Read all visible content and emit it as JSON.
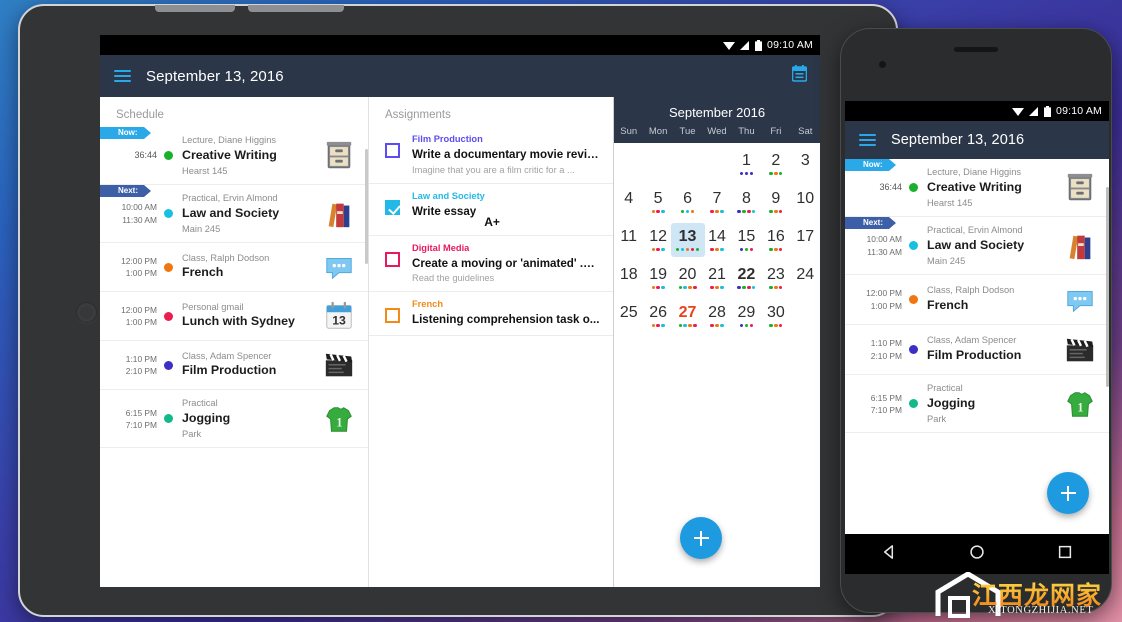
{
  "background": {
    "colors": [
      "#2f7fc4",
      "#3b2e96",
      "#e08fa6"
    ]
  },
  "statusbar": {
    "time": "09:10 AM",
    "icons": [
      "wifi-icon",
      "signal-icon",
      "battery-icon"
    ]
  },
  "appbar": {
    "menu_icon": "hamburger-menu-icon",
    "title": "September 13, 2016",
    "action_icon": "calendar-icon",
    "accent": "#29a8e8",
    "background": "#2b3648"
  },
  "schedule": {
    "header": "Schedule",
    "badges": {
      "now": "Now:",
      "next": "Next:",
      "now_color": "#2aa8e8",
      "next_color": "#3d5fa8"
    },
    "items": [
      {
        "badge": "now",
        "countdown": "36:44",
        "start": "",
        "end": "",
        "subtitle": "Lecture, Diane Higgins",
        "title": "Creative Writing",
        "location": "Hearst 145",
        "dot": "#19b02b",
        "icon": "file-cabinet-icon"
      },
      {
        "badge": "next",
        "countdown": "",
        "start": "10:00 AM",
        "end": "11:30 AM",
        "subtitle": "Practical, Ervin Almond",
        "title": "Law and Society",
        "location": "Main 245",
        "dot": "#19bfe0",
        "icon": "books-icon"
      },
      {
        "badge": "",
        "countdown": "",
        "start": "12:00 PM",
        "end": "1:00 PM",
        "subtitle": "Class, Ralph Dodson",
        "title": "French",
        "location": "",
        "dot": "#f2760f",
        "icon": "chat-bubble-icon"
      },
      {
        "badge": "",
        "countdown": "",
        "start": "12:00 PM",
        "end": "1:00 PM",
        "subtitle": "Personal gmail",
        "title": "Lunch with Sydney",
        "location": "",
        "dot": "#ea1d4e",
        "icon": "calendar-13-icon"
      },
      {
        "badge": "",
        "countdown": "",
        "start": "1:10 PM",
        "end": "2:10 PM",
        "subtitle": "Class, Adam Spencer",
        "title": "Film Production",
        "location": "",
        "dot": "#3b2fc4",
        "icon": "clapperboard-icon"
      },
      {
        "badge": "",
        "countdown": "",
        "start": "6:15 PM",
        "end": "7:10 PM",
        "subtitle": "Practical",
        "title": "Jogging",
        "location": "Park",
        "dot": "#13b98a",
        "icon": "green-shirt-icon"
      }
    ],
    "phone_items": [
      {
        "badge": "now",
        "countdown": "36:44",
        "start": "",
        "end": "",
        "subtitle": "Lecture, Diane Higgins",
        "title": "Creative Writing",
        "location": "Hearst 145",
        "dot": "#19b02b",
        "icon": "file-cabinet-icon"
      },
      {
        "badge": "next",
        "countdown": "",
        "start": "10:00 AM",
        "end": "11:30 AM",
        "subtitle": "Practical, Ervin Almond",
        "title": "Law and Society",
        "location": "Main 245",
        "dot": "#19bfe0",
        "icon": "books-icon"
      },
      {
        "badge": "",
        "countdown": "",
        "start": "12:00 PM",
        "end": "1:00 PM",
        "subtitle": "Class, Ralph Dodson",
        "title": "French",
        "location": "",
        "dot": "#f2760f",
        "icon": "chat-bubble-icon"
      },
      {
        "badge": "",
        "countdown": "",
        "start": "1:10 PM",
        "end": "2:10 PM",
        "subtitle": "Class, Adam Spencer",
        "title": "Film Production",
        "location": "",
        "dot": "#3b2fc4",
        "icon": "clapperboard-icon"
      },
      {
        "badge": "",
        "countdown": "",
        "start": "6:15 PM",
        "end": "7:10 PM",
        "subtitle": "Practical",
        "title": "Jogging",
        "location": "Park",
        "dot": "#13b98a",
        "icon": "green-shirt-icon"
      }
    ]
  },
  "assignments": {
    "header": "Assignments",
    "items": [
      {
        "course": "Film Production",
        "course_color": "#5b4df0",
        "title": "Write a documentary movie review",
        "desc": "Imagine that you are a film critic for a ...",
        "checked": false,
        "grade": ""
      },
      {
        "course": "Law and Society",
        "course_color": "#22b9e8",
        "title": "Write essay",
        "desc": "",
        "checked": true,
        "grade": "A+"
      },
      {
        "course": "Digital Media",
        "course_color": "#e8195e",
        "title": "Create a moving or 'animated' .gi...",
        "desc": "Read the guidelines",
        "checked": false,
        "grade": ""
      },
      {
        "course": "French",
        "course_color": "#f28a16",
        "title": "Listening comprehension task o...",
        "desc": "",
        "checked": false,
        "grade": ""
      }
    ]
  },
  "calendar": {
    "title": "September 2016",
    "dows": [
      "Sun",
      "Mon",
      "Tue",
      "Wed",
      "Thu",
      "Fri",
      "Sat"
    ],
    "today": 13,
    "bold_days": [
      22
    ],
    "red_days": [
      27
    ],
    "weeks": [
      [
        null,
        null,
        null,
        null,
        1,
        2,
        3
      ],
      [
        4,
        5,
        6,
        7,
        8,
        9,
        10
      ],
      [
        11,
        12,
        13,
        14,
        15,
        16,
        17
      ],
      [
        18,
        19,
        20,
        21,
        22,
        23,
        24
      ],
      [
        25,
        26,
        27,
        28,
        29,
        30,
        null
      ]
    ],
    "day_dots": {
      "1": [
        "#3b2fc4",
        "#3b2fc4",
        "#3b2fc4"
      ],
      "2": [
        "#19b02b",
        "#f2760f",
        "#19b02b"
      ],
      "5": [
        "#f2760f",
        "#ea1d4e",
        "#19bfe0"
      ],
      "6": [
        "#19b02b",
        "#19bfe0",
        "#f2760f"
      ],
      "7": [
        "#ea1d4e",
        "#f2760f",
        "#19bfe0"
      ],
      "8": [
        "#3b2fc4",
        "#19b02b",
        "#ea1d4e",
        "#19bfe0"
      ],
      "9": [
        "#19b02b",
        "#f2760f",
        "#ea1d4e"
      ],
      "12": [
        "#f2760f",
        "#ea1d4e",
        "#19bfe0"
      ],
      "13": [
        "#19b02b",
        "#19bfe0",
        "#f2760f",
        "#ea1d4e",
        "#19b02b"
      ],
      "14": [
        "#ea1d4e",
        "#f2760f",
        "#19bfe0"
      ],
      "15": [
        "#3b2fc4",
        "#19b02b",
        "#ea1d4e"
      ],
      "16": [
        "#19b02b",
        "#f2760f",
        "#ea1d4e"
      ],
      "19": [
        "#f2760f",
        "#ea1d4e",
        "#19bfe0"
      ],
      "20": [
        "#19b02b",
        "#19bfe0",
        "#f2760f",
        "#ea1d4e"
      ],
      "21": [
        "#ea1d4e",
        "#f2760f",
        "#19bfe0"
      ],
      "22": [
        "#3b2fc4",
        "#19b02b",
        "#ea1d4e",
        "#19bfe0"
      ],
      "23": [
        "#19b02b",
        "#f2760f",
        "#ea1d4e"
      ],
      "26": [
        "#f2760f",
        "#ea1d4e",
        "#19bfe0"
      ],
      "27": [
        "#19b02b",
        "#19bfe0",
        "#f2760f",
        "#ea1d4e"
      ],
      "28": [
        "#ea1d4e",
        "#f2760f",
        "#19bfe0"
      ],
      "29": [
        "#3b2fc4",
        "#19b02b",
        "#ea1d4e"
      ],
      "30": [
        "#19b02b",
        "#f2760f",
        "#ea1d4e"
      ]
    }
  },
  "fab": {
    "label": "+",
    "color": "#1e9ae0",
    "name": "add-button"
  },
  "navbar": {
    "back": "back-icon",
    "home": "home-icon",
    "recents": "recents-icon"
  },
  "watermark": {
    "cn": "江西龙网家",
    "en": "XITONGZHIJIA.NET"
  }
}
